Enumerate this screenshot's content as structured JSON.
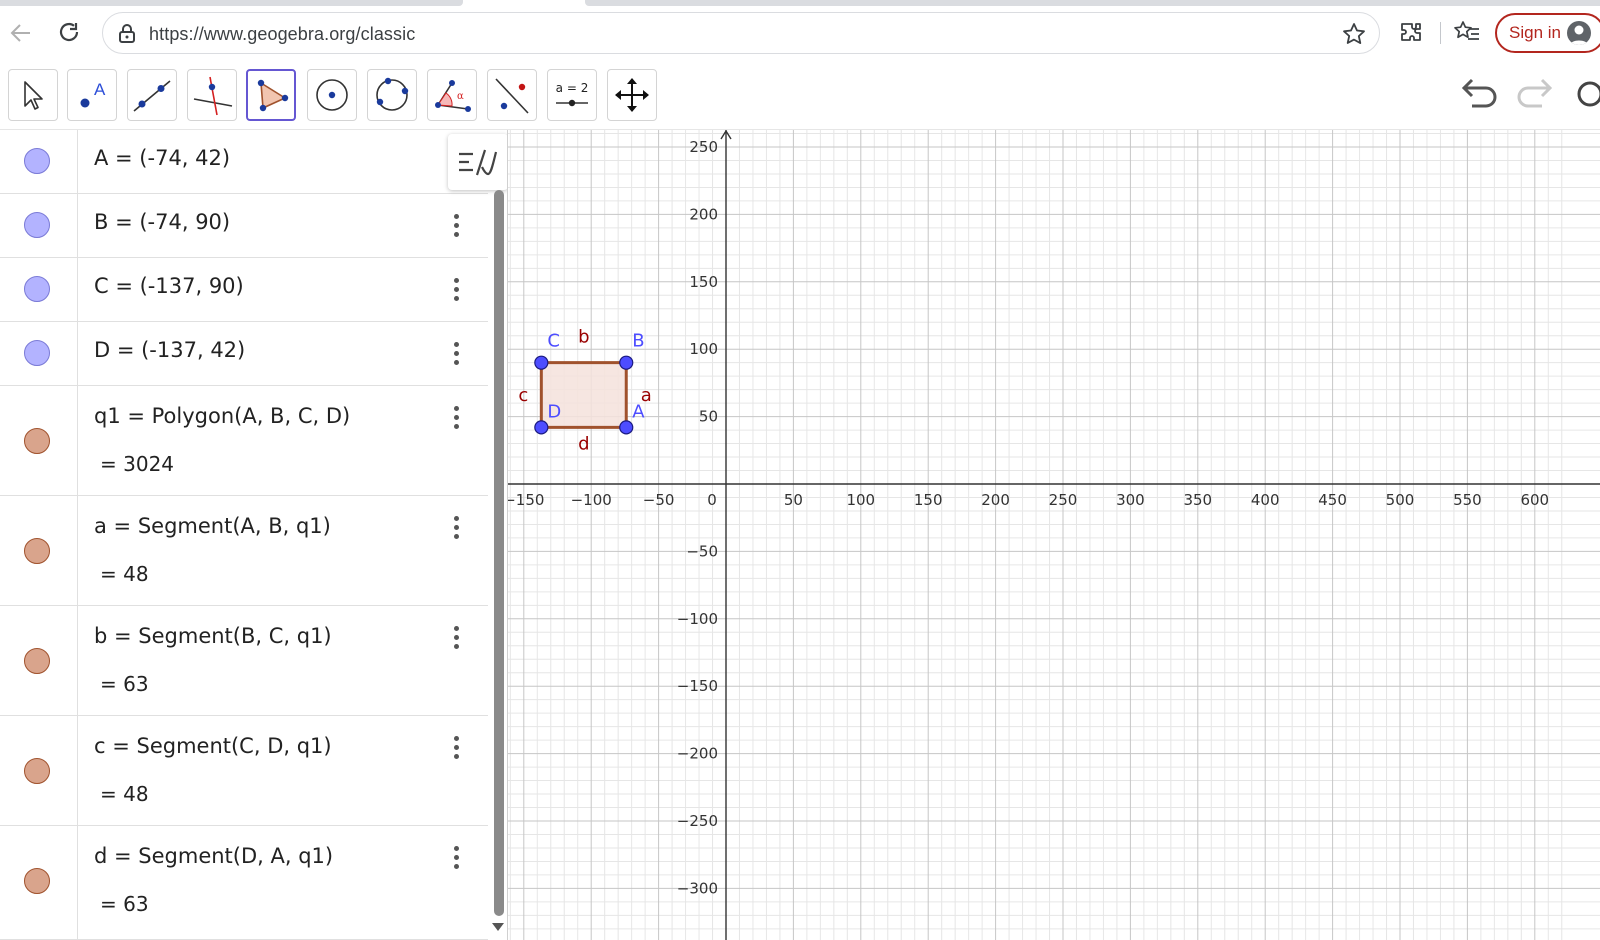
{
  "browser": {
    "url": "https://www.geogebra.org/classic",
    "signin_label": "Sign in"
  },
  "toolbar": {
    "tools": [
      {
        "name": "move-tool",
        "icon": "cursor-arrow-icon"
      },
      {
        "name": "point-tool",
        "icon": "point-icon",
        "label": "A"
      },
      {
        "name": "line-tool",
        "icon": "line-through-two-points-icon"
      },
      {
        "name": "perpendicular-line-tool",
        "icon": "perpendicular-line-icon"
      },
      {
        "name": "polygon-tool",
        "icon": "polygon-icon",
        "active": true
      },
      {
        "name": "circle-tool",
        "icon": "circle-center-point-icon"
      },
      {
        "name": "circle-three-points-tool",
        "icon": "circle-three-points-icon"
      },
      {
        "name": "angle-tool",
        "icon": "angle-icon",
        "label": "α"
      },
      {
        "name": "reflect-tool",
        "icon": "reflect-about-line-icon"
      },
      {
        "name": "slider-tool",
        "icon": "slider-icon",
        "label": "a = 2"
      },
      {
        "name": "move-graphics-view-tool",
        "icon": "move-arrows-icon"
      }
    ]
  },
  "algebra": {
    "rows": [
      {
        "def": "A = (-74, 42)",
        "value": "",
        "color": "#b3b3ff",
        "border": "#7a7ad6"
      },
      {
        "def": "B = (-74, 90)",
        "value": "",
        "color": "#b3b3ff",
        "border": "#7a7ad6"
      },
      {
        "def": "C = (-137, 90)",
        "value": "",
        "color": "#b3b3ff",
        "border": "#7a7ad6"
      },
      {
        "def": "D = (-137, 42)",
        "value": "",
        "color": "#b3b3ff",
        "border": "#7a7ad6"
      },
      {
        "def": "q1 = Polygon(A, B, C, D)",
        "value": "= 3024",
        "color": "#d9a48c",
        "border": "#a0522d"
      },
      {
        "def": "a = Segment(A, B, q1)",
        "value": "= 48",
        "color": "#d9a48c",
        "border": "#a0522d"
      },
      {
        "def": "b = Segment(B, C, q1)",
        "value": "= 63",
        "color": "#d9a48c",
        "border": "#a0522d"
      },
      {
        "def": "c = Segment(C, D, q1)",
        "value": "= 48",
        "color": "#d9a48c",
        "border": "#a0522d"
      },
      {
        "def": "d = Segment(D, A, q1)",
        "value": "= 63",
        "color": "#d9a48c",
        "border": "#a0522d"
      }
    ]
  },
  "graphics": {
    "x_ticks": [
      "−150",
      "−100",
      "−50",
      "0",
      "50",
      "100",
      "150",
      "200",
      "250",
      "300",
      "350",
      "400",
      "450",
      "500",
      "550",
      "600"
    ],
    "y_ticks": [
      "250",
      "200",
      "150",
      "100",
      "50",
      "−50",
      "−100",
      "−150",
      "−200",
      "−250",
      "−300"
    ],
    "x_tick_values": [
      -150,
      -100,
      -50,
      0,
      50,
      100,
      150,
      200,
      250,
      300,
      350,
      400,
      450,
      500,
      550,
      600
    ],
    "y_tick_values": [
      250,
      200,
      150,
      100,
      50,
      -50,
      -100,
      -150,
      -200,
      -250,
      -300
    ],
    "points": [
      {
        "label": "A",
        "x": -74,
        "y": 42
      },
      {
        "label": "B",
        "x": -74,
        "y": 90
      },
      {
        "label": "C",
        "x": -137,
        "y": 90
      },
      {
        "label": "D",
        "x": -137,
        "y": 42
      }
    ],
    "segment_labels": [
      "a",
      "b",
      "c",
      "d"
    ],
    "colors": {
      "point": "#4d4dff",
      "segment": "#a0522d",
      "segment_label": "#990000",
      "point_label": "#4d4dff",
      "polygon_fill": "#f4e2dc",
      "grid_major": "#c6c6c6",
      "grid_minor": "#e6e6e6",
      "axis": "#333333"
    }
  }
}
